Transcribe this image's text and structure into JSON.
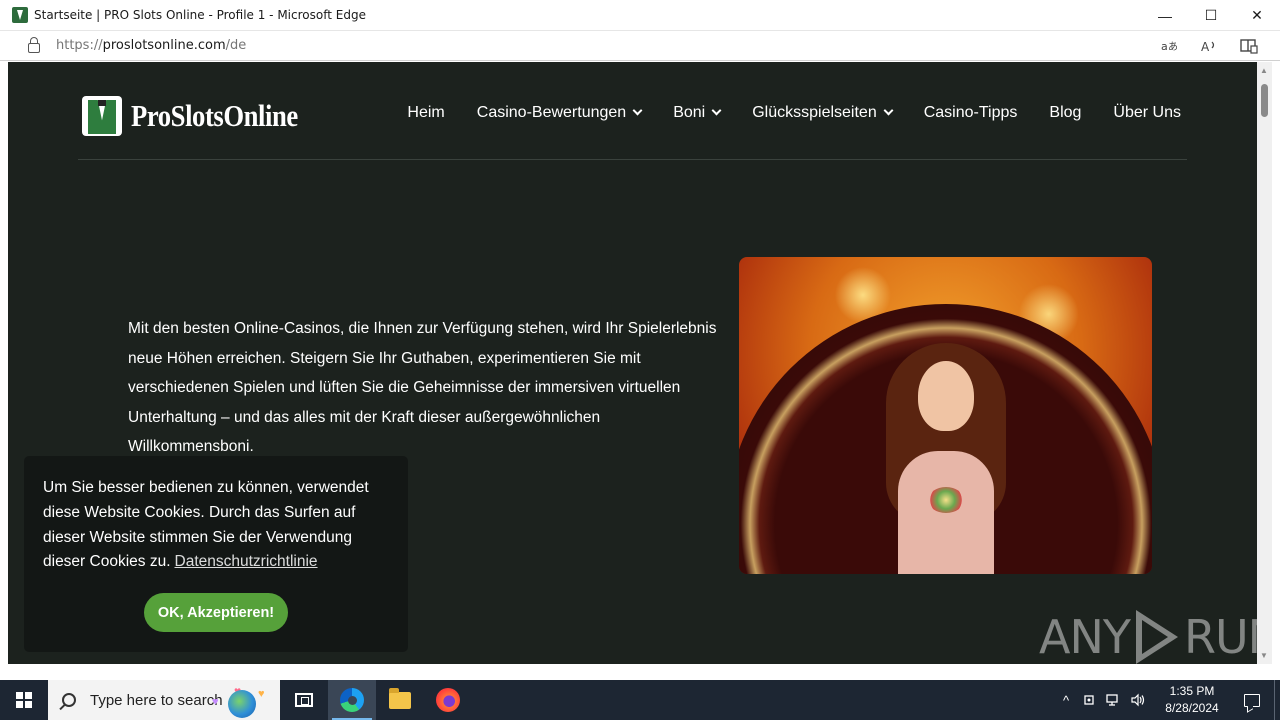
{
  "window": {
    "title": "Startseite | PRO Slots Online - Profile 1 - Microsoft Edge",
    "controls": {
      "minimize": "—",
      "maximize": "☐",
      "close": "✕"
    }
  },
  "address_bar": {
    "scheme": "https://",
    "host": "proslotsonline.com",
    "path": "/de",
    "icons": [
      "translate-icon",
      "read-aloud-icon",
      "immersive-reader-icon"
    ]
  },
  "site": {
    "logo_text": "ProSlotsOnline",
    "nav": [
      {
        "label": "Heim",
        "dropdown": false
      },
      {
        "label": "Casino-Bewertungen",
        "dropdown": true
      },
      {
        "label": "Boni",
        "dropdown": true
      },
      {
        "label": "Glücksspielseiten",
        "dropdown": true
      },
      {
        "label": "Casino-Tipps",
        "dropdown": false
      },
      {
        "label": "Blog",
        "dropdown": false
      },
      {
        "label": "Über Uns",
        "dropdown": false
      }
    ],
    "hero_text": "Mit den besten Online-Casinos, die Ihnen zur Verfügung stehen, wird Ihr Spielerlebnis neue Höhen erreichen. Steigern Sie Ihr Guthaben, experimentieren Sie mit verschiedenen Spielen und lüften Sie die Geheimnisse der immersiven virtuellen Unterhaltung – und das alles mit der Kraft dieser außergewöhnlichen Willkommensboni."
  },
  "cookie_banner": {
    "message": "Um Sie besser bedienen zu können, verwendet diese Website Cookies. Durch das Surfen auf dieser Website stimmen Sie der Verwendung dieser Cookies zu.",
    "link_label": "Datenschutzrichtlinie",
    "accept_label": "OK, Akzeptieren!"
  },
  "watermark": {
    "text_left": "ANY",
    "text_right": "RUN"
  },
  "taskbar": {
    "search_placeholder": "Type here to search",
    "clock_time": "1:35 PM",
    "clock_date": "8/28/2024",
    "tray_chevron": "^"
  },
  "colors": {
    "page_bg": "#1c221e",
    "accent_green": "#56a13a",
    "taskbar_bg": "#1d2633"
  }
}
